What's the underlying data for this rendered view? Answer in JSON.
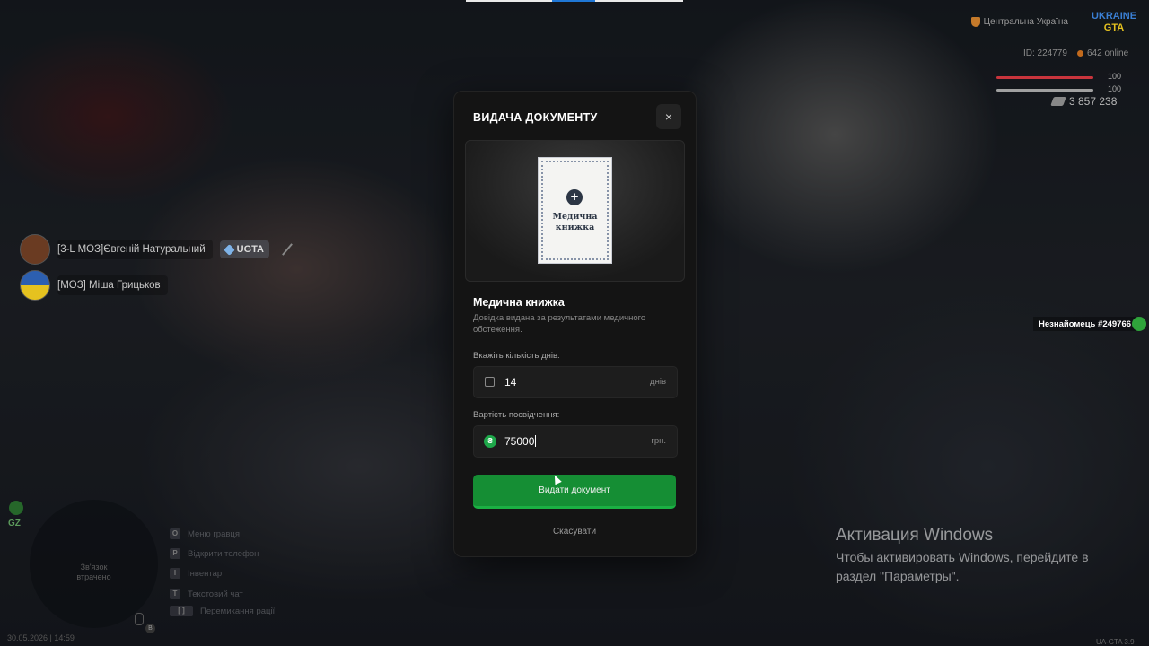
{
  "hud": {
    "region": "Центральна Україна",
    "logo_text_1": "UKRAINE",
    "logo_text_2": "GTA",
    "player_id": "ID: 224779",
    "online": "642 online",
    "health": "100",
    "armor": "100",
    "money": "3 857 238",
    "colors": {
      "health": "#c9343c",
      "online_dot": "#c26a1d"
    }
  },
  "voice_chat": [
    {
      "name": "[3-L МОЗ]Євгеній Натуральний",
      "badge": "UGTA",
      "muted_icon": "mic-off-icon"
    },
    {
      "name": "[МОЗ] Міша Грицьков"
    }
  ],
  "nametag": {
    "label": "Незнайомець #249766"
  },
  "minimap": {
    "gz": "GZ",
    "status_line1": "Зв'язок",
    "status_line2": "втрачено",
    "mic_key": "B",
    "datetime": "30.05.2026 | 14:59"
  },
  "key_hints": [
    {
      "key": "O",
      "label": "Меню гравця"
    },
    {
      "key": "P",
      "label": "Відкрити телефон"
    },
    {
      "key": "I",
      "label": "Інвентар"
    },
    {
      "key": "T",
      "label": "Текстовий чат"
    },
    {
      "key": "[ ]",
      "label": "Перемикання рації"
    }
  ],
  "modal": {
    "title": "ВИДАЧА ДОКУМЕНТУ",
    "close": "×",
    "doc_title_line1": "Медична",
    "doc_title_line2": "книжка",
    "doc_plus": "+",
    "name": "Медична книжка",
    "description": "Довідка видана за результатами медичного обстеження.",
    "days_label": "Вкажіть кількість днів:",
    "days_value": "14",
    "days_suffix": "днів",
    "price_label": "Вартість посвідчення:",
    "price_value": "75000",
    "price_suffix": "грн.",
    "currency_symbol": "₴",
    "submit": "Видати документ",
    "cancel": "Скасувати",
    "colors": {
      "submit": "#158e34",
      "coin": "#1ea84a"
    }
  },
  "windows_watermark": {
    "title": "Активация Windows",
    "text": "Чтобы активировать Windows, перейдите в раздел \"Параметры\"."
  },
  "version": "UA-GTA 3.9"
}
